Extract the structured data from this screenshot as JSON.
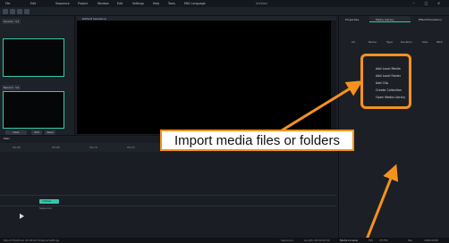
{
  "window": {
    "menu": [
      "File",
      "Edit",
      "Sequence",
      "Project",
      "Window",
      "Edit",
      "Settings",
      "Help",
      "Tools",
      "ENG Language"
    ],
    "title": "Untitled"
  },
  "left_panel": {
    "source_tab": "Source - V1",
    "record_tab": "Record - V1",
    "buttons": [
      "Clear",
      "Add",
      "Save"
    ]
  },
  "program_monitor": {
    "tab": "Default Sequence"
  },
  "timeline": {
    "title": "Main",
    "ruler_labels": [
      "00:00",
      "00:05",
      "00:10",
      "00:15",
      "00:20",
      "00:25",
      "00:30",
      "00:35",
      "00:40"
    ],
    "track_label": "Sequence",
    "clip_label": "Untitled"
  },
  "right_panel": {
    "tabs": [
      "Properties",
      "Media Library",
      "Effect/Transitions"
    ],
    "columns": [
      "All",
      "Name",
      "Type",
      "Duration",
      "Size",
      "Path"
    ],
    "import_menu": [
      "Add Local Media",
      "Add Local Folder",
      "Add Clip",
      "Create Collection",
      "Open Media Library"
    ]
  },
  "annotation": {
    "callout_text": "Import media files or folders",
    "arrow_color": "#f5921e"
  },
  "statusbar": {
    "left_text": "Export FileDriver 00:00:00  Timeline Settings",
    "right_items": [
      "Sequence",
      "Length: 00:00:00:00",
      "Media browser",
      "FPS",
      "25 FPS",
      "Res",
      "1920x1080"
    ]
  },
  "colors": {
    "accent": "#36c9ab",
    "callout_border": "#f5921e",
    "background": "#1b1e24"
  }
}
